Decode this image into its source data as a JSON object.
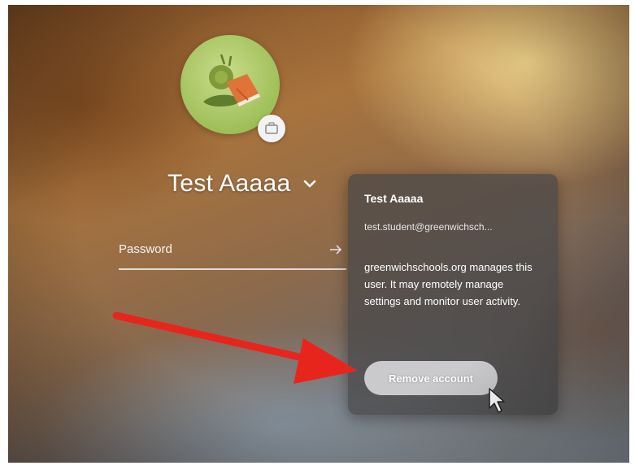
{
  "user": {
    "name": "Test Aaaaa"
  },
  "password_field": {
    "placeholder": "Password"
  },
  "popup": {
    "name": "Test Aaaaa",
    "email": "test.student@greenwichsch...",
    "notice": "greenwichschools.org manages this user. It may remotely manage settings and monitor user activity.",
    "remove_button_label": "Remove account"
  },
  "icons": {
    "avatar": "snail-reading-book-icon",
    "badge": "briefcase-icon",
    "chevron": "chevron-down-icon",
    "submit": "arrow-right-icon",
    "annotation": "red-arrow-annotation",
    "cursor": "mouse-pointer-icon"
  },
  "colors": {
    "annotation_arrow": "#e8251d",
    "popup_background": "#464648",
    "button_background": "#d7d7da"
  }
}
